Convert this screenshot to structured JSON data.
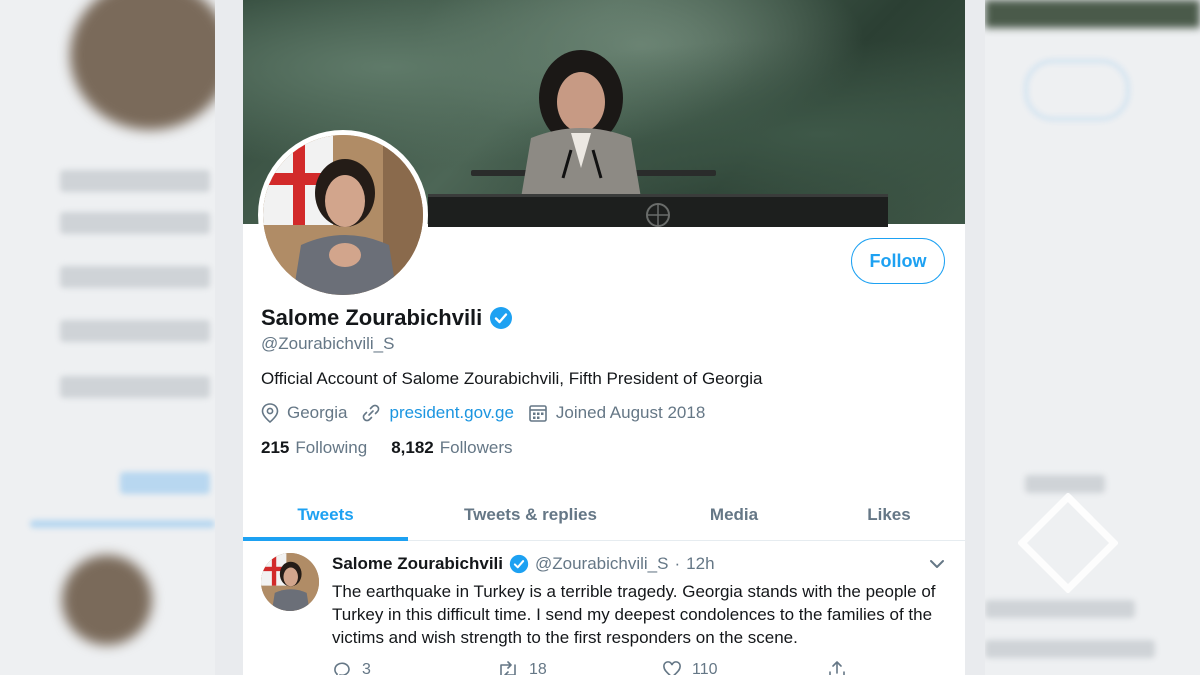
{
  "profile": {
    "display_name": "Salome Zourabichvili",
    "handle": "@Zourabichvili_S",
    "bio": "Official Account of Salome Zourabichvili, Fifth President of Georgia",
    "location": "Georgia",
    "website": "president.gov.ge",
    "joined": "Joined August 2018",
    "following_count": "215",
    "following_label": "Following",
    "followers_count": "8,182",
    "followers_label": "Followers",
    "follow_label": "Follow"
  },
  "tabs": [
    {
      "label": "Tweets",
      "active": true
    },
    {
      "label": "Tweets & replies",
      "active": false
    },
    {
      "label": "Media",
      "active": false
    },
    {
      "label": "Likes",
      "active": false
    }
  ],
  "tweet": {
    "name": "Salome Zourabichvili",
    "handle": "@Zourabichvili_S",
    "separator": "·",
    "time": "12h",
    "text": "The earthquake in Turkey is a terrible tragedy. Georgia stands with the people of Turkey in this difficult time. I send my deepest condolences to the families of the victims and wish strength to the first responders on the scene.",
    "replies": "3",
    "retweets": "18",
    "likes": "110"
  },
  "colors": {
    "accent": "#1da1f2",
    "link": "#1b95e0",
    "text_primary": "#14171a",
    "text_secondary": "#657786"
  }
}
